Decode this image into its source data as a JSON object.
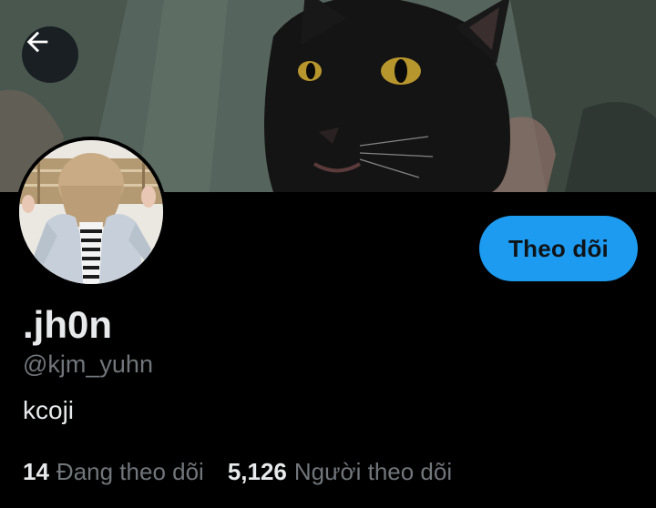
{
  "profile": {
    "display_name": ".jh0n",
    "handle": "@kjm_yuhn",
    "bio": "kcoji"
  },
  "actions": {
    "follow_label": "Theo dõi",
    "back_icon": "arrow-left-icon"
  },
  "stats": {
    "following_count": "14",
    "following_label": "Đang theo dõi",
    "followers_count": "5,126",
    "followers_label": "Người theo dõi"
  },
  "colors": {
    "background": "#000000",
    "accent": "#1d9bf0",
    "primary_text": "#e7e9ea",
    "secondary_text": "#71767b"
  }
}
